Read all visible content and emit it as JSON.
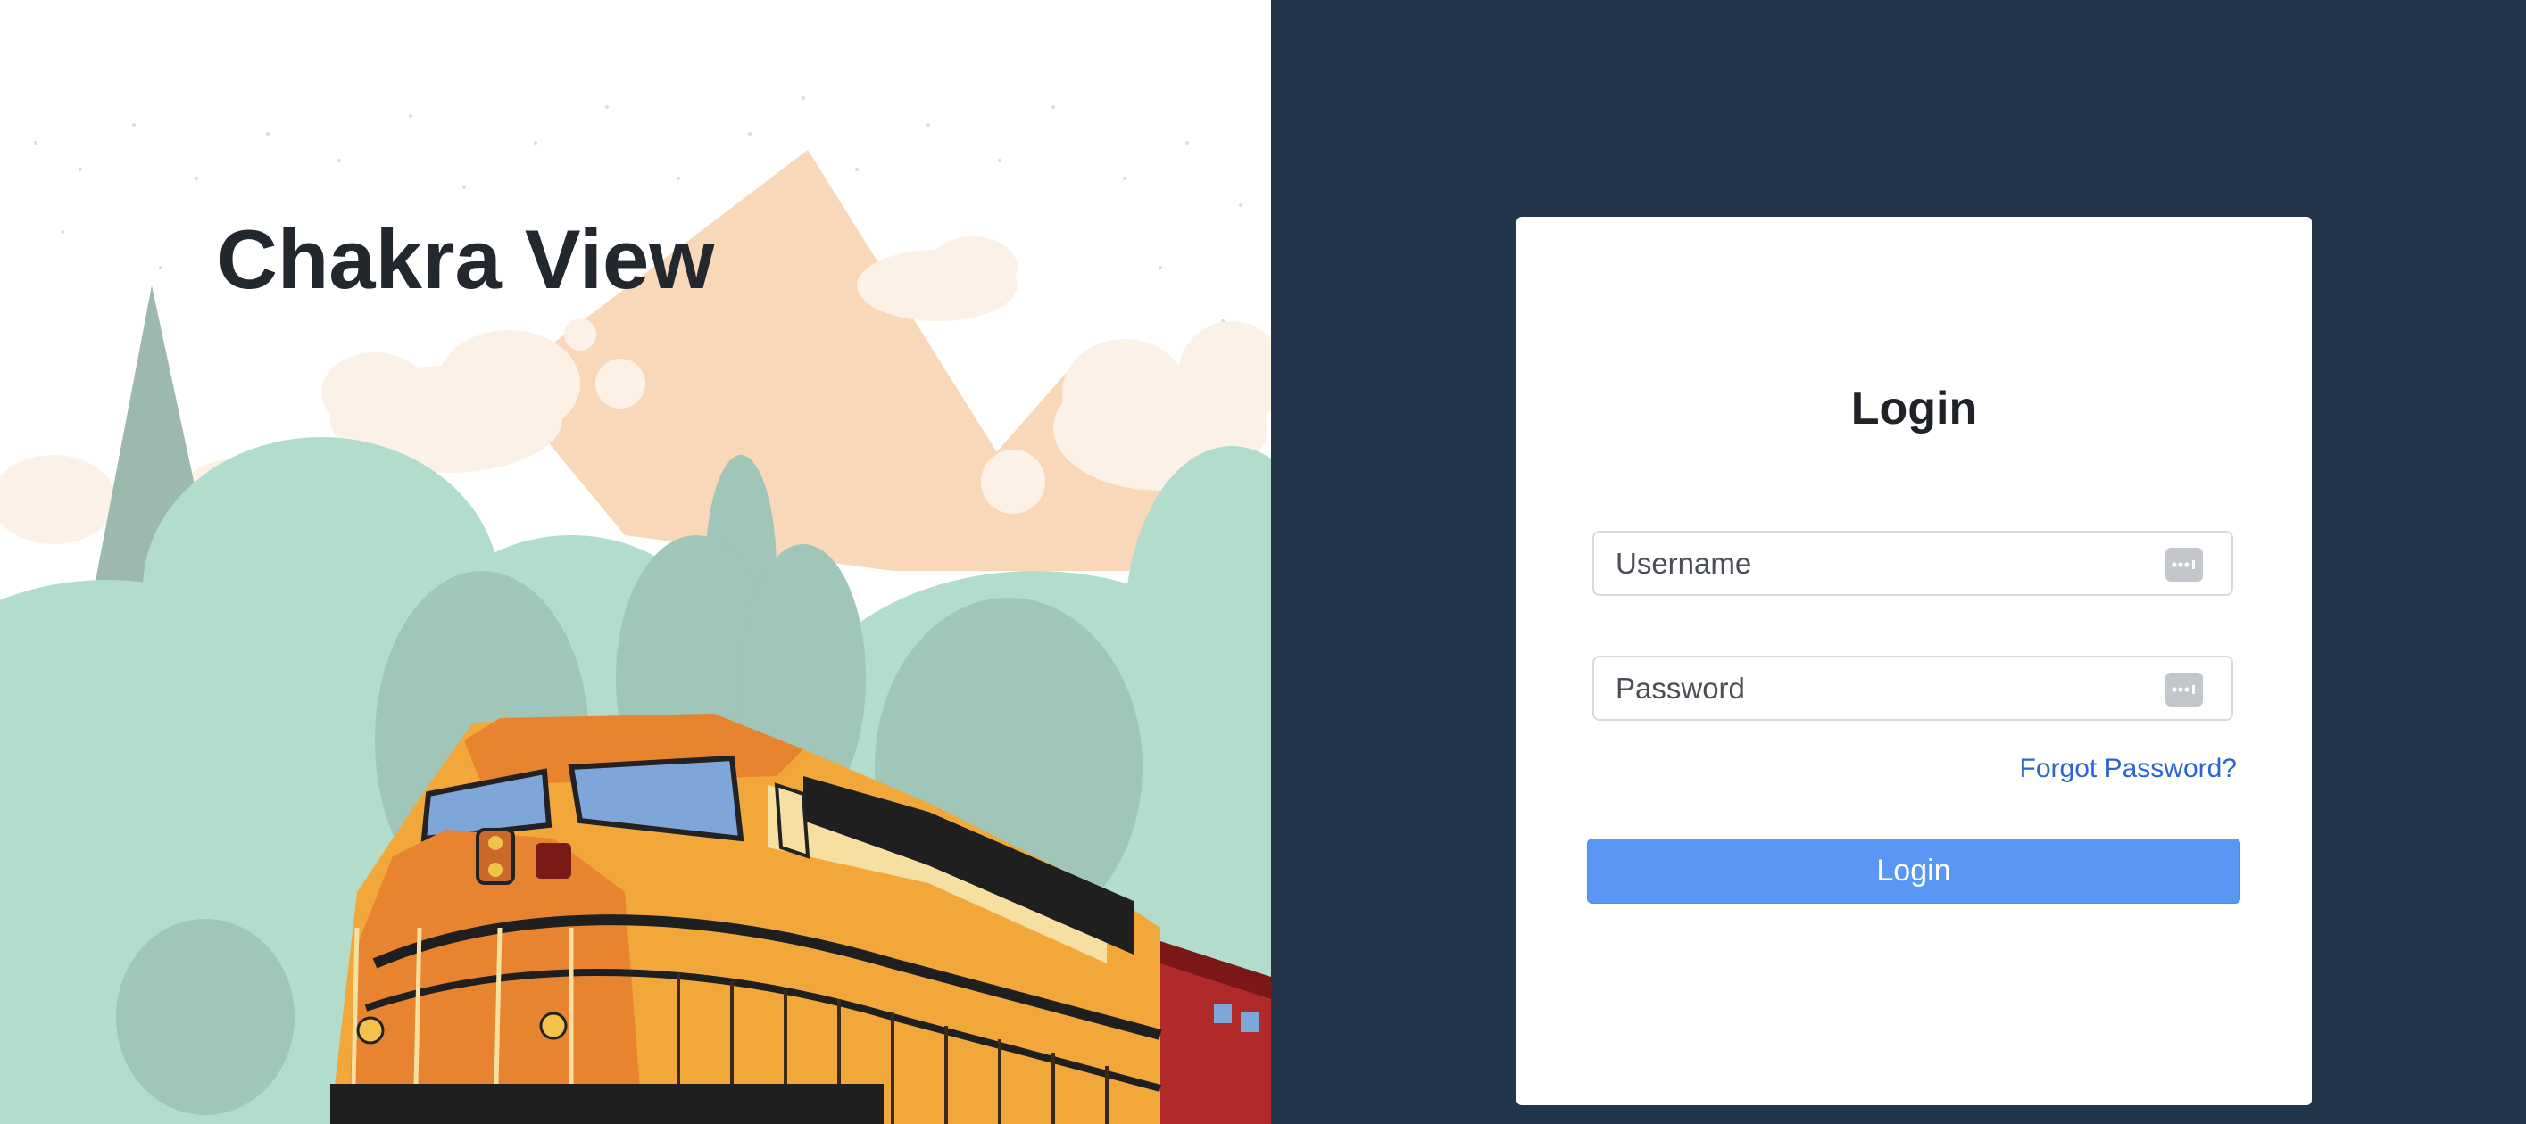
{
  "brand": {
    "title": "Chakra View"
  },
  "login_card": {
    "title": "Login",
    "username": {
      "placeholder": "Username",
      "value": "",
      "icon": "password-manager-key-icon"
    },
    "password": {
      "placeholder": "Password",
      "value": "",
      "icon": "password-manager-key-icon"
    },
    "forgot_password_label": "Forgot Password?",
    "submit_label": "Login"
  },
  "illustration": {
    "subject": "train-in-forest-icon"
  },
  "colors": {
    "panel_background": "#22354b",
    "card_background": "#ffffff",
    "button_primary": "#5a97f5",
    "link": "#2c63d6",
    "title_text": "#23272e"
  }
}
